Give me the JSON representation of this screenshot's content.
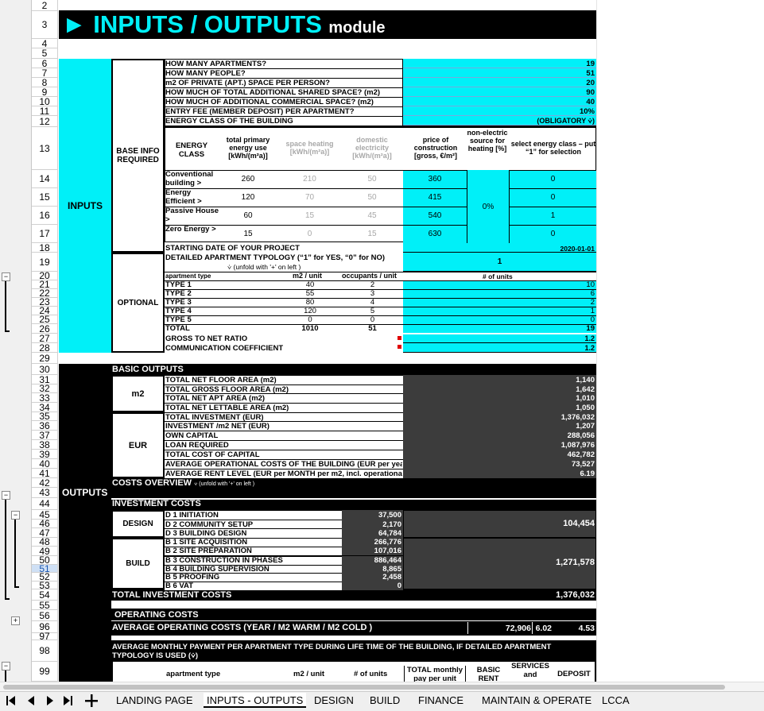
{
  "title": {
    "main": "► INPUTS / OUTPUTS",
    "sub": "module"
  },
  "row_numbers": [
    "2",
    "3",
    "4",
    "5",
    "6",
    "7",
    "8",
    "9",
    "10",
    "11",
    "12",
    "13",
    "14",
    "15",
    "16",
    "17",
    "18",
    "19",
    "20",
    "21",
    "22",
    "23",
    "24",
    "25",
    "26",
    "27",
    "28",
    "29",
    "30",
    "31",
    "32",
    "33",
    "34",
    "35",
    "36",
    "37",
    "38",
    "39",
    "40",
    "41",
    "42",
    "43",
    "44",
    "45",
    "46",
    "47",
    "48",
    "49",
    "50",
    "51",
    "52",
    "53",
    "54",
    "55",
    "56",
    "96",
    "97",
    "98",
    "99"
  ],
  "selected_row": "51",
  "sections": {
    "inputs": "INPUTS",
    "outputs": "OUTPUTS",
    "base_info": "BASE INFO REQUIRED",
    "optional": "OPTIONAL"
  },
  "questions": [
    {
      "q": "HOW MANY APARTMENTS?",
      "v": "19"
    },
    {
      "q": "HOW MANY PEOPLE?",
      "v": "51"
    },
    {
      "q": "m2 OF PRIVATE (APT.) SPACE PER PERSON?",
      "v": "20"
    },
    {
      "q": "HOW MUCH OF TOTAL ADDITIONAL SHARED SPACE? (m2)",
      "v": "90"
    },
    {
      "q": "HOW MUCH OF ADDITIONAL COMMERCIAL SPACE? (m2)",
      "v": "40"
    },
    {
      "q": "ENTRY FEE (MEMBER DEPOSIT) PER APARTMENT?",
      "v": "10%"
    },
    {
      "q": "ENERGY CLASS OF THE BUILDING",
      "v": "(OBLIGATORY ⩒)"
    }
  ],
  "energy_header": {
    "class": "ENERGY CLASS",
    "primary": "total primary energy use [kWh/(m²a)]",
    "space": "space heating [kWh/(m²a)]",
    "domestic": "domestic electricity [kWh/(m²a)]",
    "price": "price of construction [gross, €/m²]",
    "nonelectric": "non-electric source for heating [%]",
    "select": "select energy class – put “1” for selection"
  },
  "energy_rows": [
    {
      "name": "Conventional building >",
      "primary": "260",
      "space": "210",
      "domestic": "50",
      "price": "360",
      "select": "0"
    },
    {
      "name": "Energy Efficient >",
      "primary": "120",
      "space": "70",
      "domestic": "50",
      "price": "415",
      "select": "0"
    },
    {
      "name": "Passive House >",
      "primary": "60",
      "space": "15",
      "domestic": "45",
      "price": "540",
      "select": "1"
    },
    {
      "name": "Zero Energy >",
      "primary": "15",
      "space": "0",
      "domestic": "15",
      "price": "630",
      "select": "0"
    }
  ],
  "nonelectric_value": "0%",
  "start_date": {
    "label": "STARTING DATE OF YOUR PROJECT",
    "value": "2020-01-01"
  },
  "typology": {
    "label": "DETAILED APARTMENT TYPOLOGY (“1” for YES, “0” for NO)",
    "hint": "⩒ (unfold with '+' on left )",
    "value": "1"
  },
  "apt_header": {
    "type": "apartment type",
    "m2": "m2 / unit",
    "occ": "occupants / unit",
    "units": "# of units"
  },
  "apt_rows": [
    {
      "t": "TYPE 1",
      "m2": "40",
      "occ": "2",
      "n": "10"
    },
    {
      "t": "TYPE 2",
      "m2": "55",
      "occ": "3",
      "n": "6"
    },
    {
      "t": "TYPE 3",
      "m2": "80",
      "occ": "4",
      "n": "2"
    },
    {
      "t": "TYPE 4",
      "m2": "120",
      "occ": "5",
      "n": "1"
    },
    {
      "t": "TYPE 5",
      "m2": "0",
      "occ": "0",
      "n": "0"
    }
  ],
  "apt_total": {
    "t": "TOTAL",
    "m2": "1010",
    "occ": "51",
    "n": "19"
  },
  "gross_ratio": {
    "label": "GROSS TO NET RATIO",
    "v": "1.2"
  },
  "comm_coef": {
    "label": "COMMUNICATION COEFFICIENT",
    "v": "1.2"
  },
  "basic_outputs": {
    "title": "BASIC OUTPUTS",
    "m2_label": "m2",
    "eur_label": "EUR",
    "rows": [
      {
        "q": "TOTAL NET FLOOR AREA (m2)",
        "v": "1,140"
      },
      {
        "q": "TOTAL GROSS FLOOR AREA (m2)",
        "v": "1,642"
      },
      {
        "q": "TOTAL NET APT AREA (m2)",
        "v": "1,010"
      },
      {
        "q": "TOTAL NET LETTABLE AREA (m2)",
        "v": "1,050"
      },
      {
        "q": "TOTAL INVESTMENT (EUR)",
        "v": "1,376,032"
      },
      {
        "q": "INVESTMENT /m2 NET (EUR)",
        "v": "1,207"
      },
      {
        "q": "OWN CAPITAL",
        "v": "288,056"
      },
      {
        "q": "LOAN REQUIRED",
        "v": "1,087,976"
      },
      {
        "q": "TOTAL COST OF CAPITAL",
        "v": "462,782"
      },
      {
        "q": "AVERAGE OPERATIONAL COSTS OF THE BUILDING (EUR per year)",
        "v": "73,527"
      },
      {
        "q": "AVERAGE RENT LEVEL (EUR per MONTH per m2, incl. operational costs)",
        "v": "6.19"
      }
    ]
  },
  "costs_overview": {
    "title": "COSTS OVERVIEW",
    "hint": "⩒ (unfold with '+' on left )"
  },
  "investment_costs": {
    "title": "INVESTMENT COSTS",
    "design_label": "DESIGN",
    "build_label": "BUILD",
    "design_rows": [
      {
        "q": "D 1 INITIATION",
        "v": "37,500"
      },
      {
        "q": "D 2 COMMUNITY SETUP",
        "v": "2,170"
      },
      {
        "q": "D 3 BUILDING DESIGN",
        "v": "64,784"
      }
    ],
    "design_total": "104,454",
    "build_rows": [
      {
        "q": "B 1 SITE ACQUISITION",
        "v": "266,776"
      },
      {
        "q": "B 2 SITE PREPARATION",
        "v": "107,016"
      },
      {
        "q": "B 3 CONSTRUCTION IN PHASES",
        "v": "886,464"
      },
      {
        "q": "B 4 BUILDING SUPERVISION",
        "v": "8,865"
      },
      {
        "q": "B 5 PROOFING",
        "v": "2,458"
      },
      {
        "q": "B 6 VAT",
        "v": "0"
      }
    ],
    "build_total": "1,271,578",
    "total_label": "TOTAL INVESTMENT COSTS",
    "total": "1,376,032"
  },
  "operating": {
    "title": "OPERATING COSTS",
    "avg_label": "AVERAGE OPERATING COSTS (YEAR / M2 WARM / M2 COLD )",
    "year": "72,906",
    "warm": "6.02",
    "cold": "4.53"
  },
  "monthly": {
    "title": "AVERAGE MONTHLY PAYMENT PER APARTMENT TYPE DURING LIFE TIME OF THE BUILDING, IF DETAILED APARTMENT TYPOLOGY IS USED (⩒)",
    "h_type": "apartment type",
    "h_m2": "m2 / unit",
    "h_units": "# of units",
    "h_total": "TOTAL monthly pay per unit",
    "h_rent": "BASIC RENT",
    "h_services": "SERVICES and",
    "h_deposit": "DEPOSIT"
  },
  "tabs": [
    "LANDING PAGE",
    "INPUTS - OUTPUTS",
    "DESIGN",
    "BUILD",
    "FINANCE",
    "MAINTAIN & OPERATE",
    "LCCA"
  ],
  "active_tab": "INPUTS - OUTPUTS",
  "colors": {
    "accent": "#00f0f8",
    "dark": "#3c3c3c",
    "black": "#000000"
  }
}
